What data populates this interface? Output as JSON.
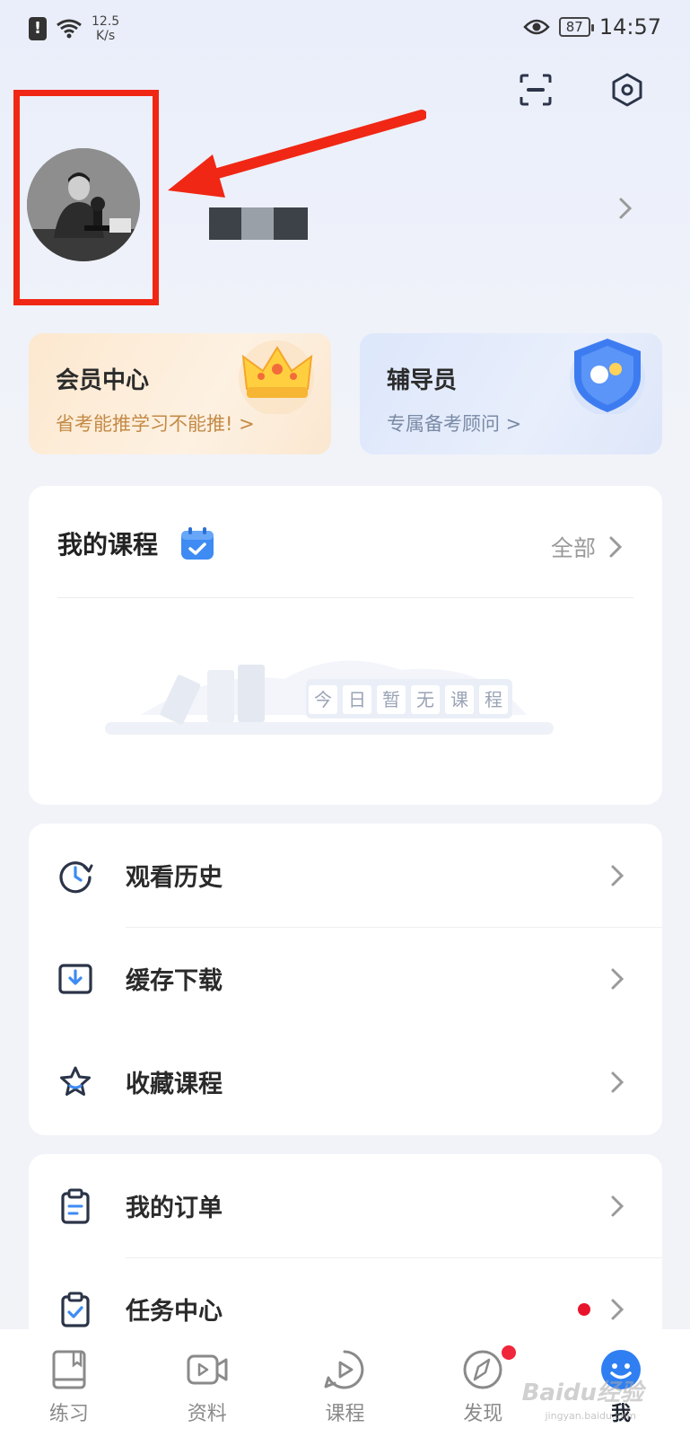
{
  "status_bar": {
    "speed_value": "12.5",
    "speed_unit": "K/s",
    "battery": "87",
    "time": "14:57"
  },
  "top_icons": [
    "scan-icon",
    "settings-icon"
  ],
  "profile": {
    "username_masked": true
  },
  "cards": [
    {
      "title": "会员中心",
      "subtitle": "省考能推学习不能推! >",
      "icon": "crown-icon"
    },
    {
      "title": "辅导员",
      "subtitle": "专属备考顾问 >",
      "icon": "shield-icon"
    }
  ],
  "courses": {
    "title": "我的课程",
    "all_label": "全部",
    "empty_text": [
      "今",
      "日",
      "暂",
      "无",
      "课",
      "程"
    ]
  },
  "menu1": [
    {
      "label": "观看历史",
      "icon": "clock-icon"
    },
    {
      "label": "缓存下载",
      "icon": "download-icon"
    },
    {
      "label": "收藏课程",
      "icon": "star-icon"
    }
  ],
  "menu2": [
    {
      "label": "我的订单",
      "icon": "clipboard-icon"
    },
    {
      "label": "任务中心",
      "icon": "task-icon"
    }
  ],
  "tabs": [
    {
      "label": "练习",
      "icon": "book-icon"
    },
    {
      "label": "资料",
      "icon": "video-icon"
    },
    {
      "label": "课程",
      "icon": "play-circle-icon"
    },
    {
      "label": "发现",
      "icon": "compass-icon"
    },
    {
      "label": "我",
      "icon": "smile-icon"
    }
  ],
  "watermark": {
    "main": "Baidu经验",
    "sub": "jingyan.baidu.com"
  },
  "colors": {
    "accent": "#3b82f6",
    "highlight": "#f02714",
    "notification": "#e8142b"
  }
}
